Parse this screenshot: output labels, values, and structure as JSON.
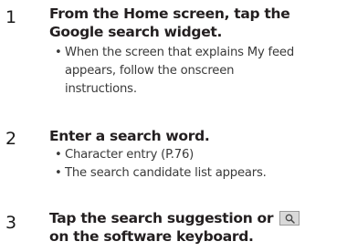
{
  "steps": [
    {
      "number": "1",
      "heading_lines": [
        "From the Home screen, tap the",
        "Google search widget."
      ],
      "bullets": [
        {
          "lines": [
            "When the screen that explains My feed",
            "appears, follow the onscreen",
            "instructions."
          ]
        }
      ]
    },
    {
      "number": "2",
      "heading_lines": [
        "Enter a search word."
      ],
      "bullets": [
        {
          "lines": [
            "Character entry (P.76)"
          ]
        },
        {
          "lines": [
            "The search candidate list appears."
          ]
        }
      ]
    },
    {
      "number": "3",
      "heading_part1": "Tap the search suggestion or",
      "heading_icon": "search-key-icon",
      "heading_line2": "on the software keyboard."
    }
  ]
}
